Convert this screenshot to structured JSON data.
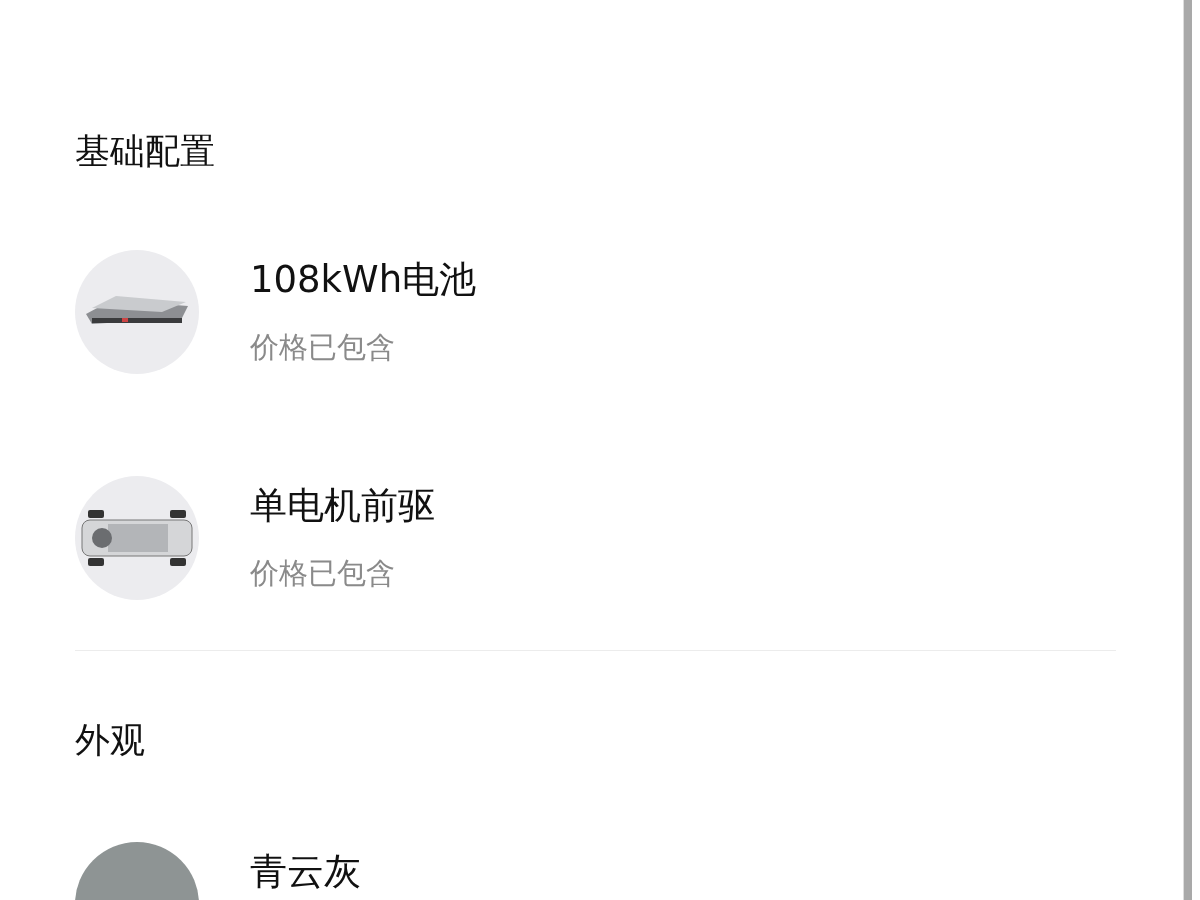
{
  "sections": [
    {
      "title": "基础配置",
      "divider_after": true,
      "items": [
        {
          "kind": "battery",
          "name": "108kWh电池",
          "note": "价格已包含"
        },
        {
          "kind": "chassis",
          "name": "单电机前驱",
          "note": "价格已包含"
        }
      ]
    },
    {
      "title": "外观",
      "divider_after": false,
      "items": [
        {
          "kind": "swatch",
          "color": "#8e9494",
          "name": "青云灰"
        }
      ]
    }
  ]
}
